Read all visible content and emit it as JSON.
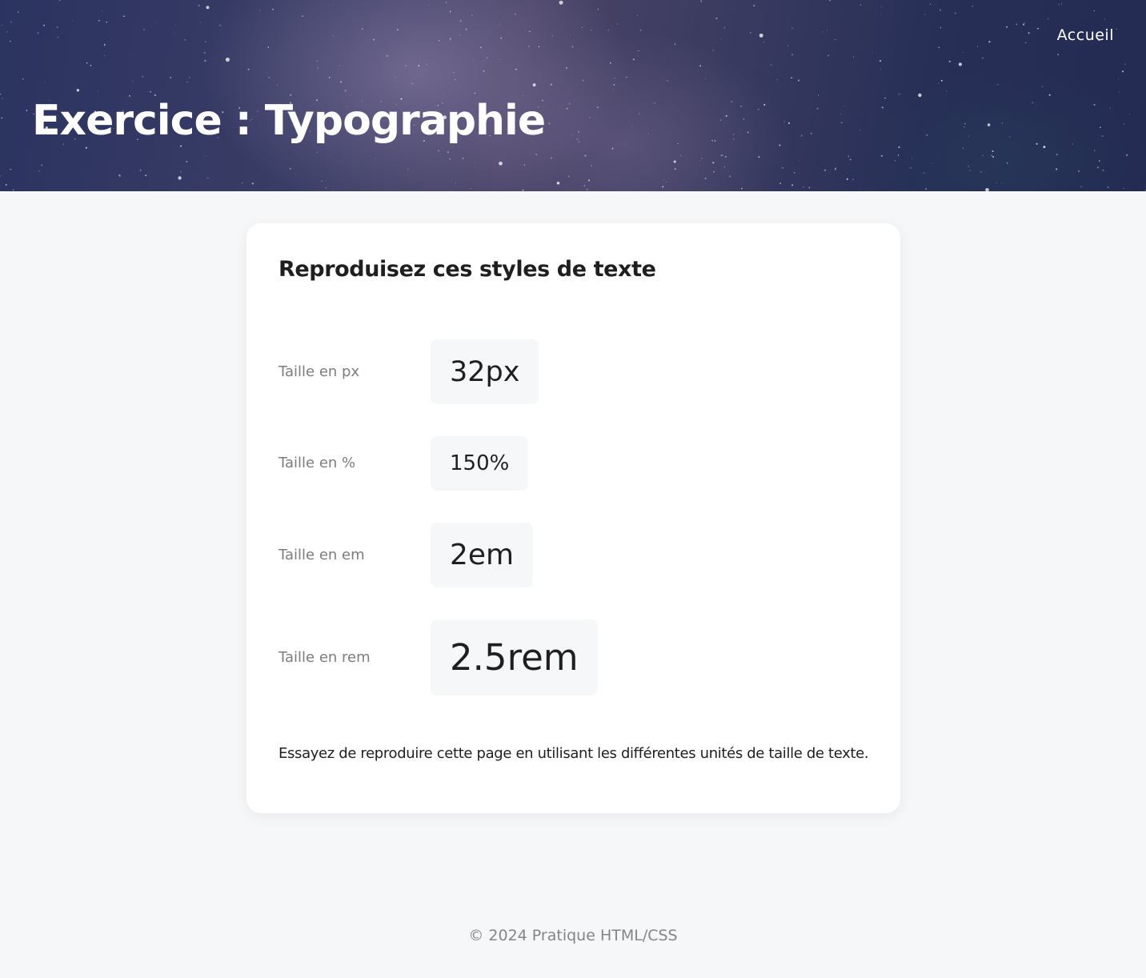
{
  "header": {
    "nav_link": "Accueil",
    "title": "Exercice : Typographie"
  },
  "card": {
    "title": "Reproduisez ces styles de texte",
    "rows": [
      {
        "label": "Taille en px",
        "sample": "32px"
      },
      {
        "label": "Taille en %",
        "sample": "150%"
      },
      {
        "label": "Taille en em",
        "sample": "2em"
      },
      {
        "label": "Taille en rem",
        "sample": "2.5rem"
      }
    ],
    "note": "Essayez de reproduire cette page en utilisant les différentes unités de taille de texte."
  },
  "footer": {
    "text": "© 2024 Pratique HTML/CSS"
  },
  "colors": {
    "page_background": "#f6f7f9",
    "card_background": "#ffffff",
    "sample_background": "#f6f7f9",
    "label_text": "#7d7d7d",
    "footer_text": "#858585",
    "hero_text": "#ffffff"
  }
}
